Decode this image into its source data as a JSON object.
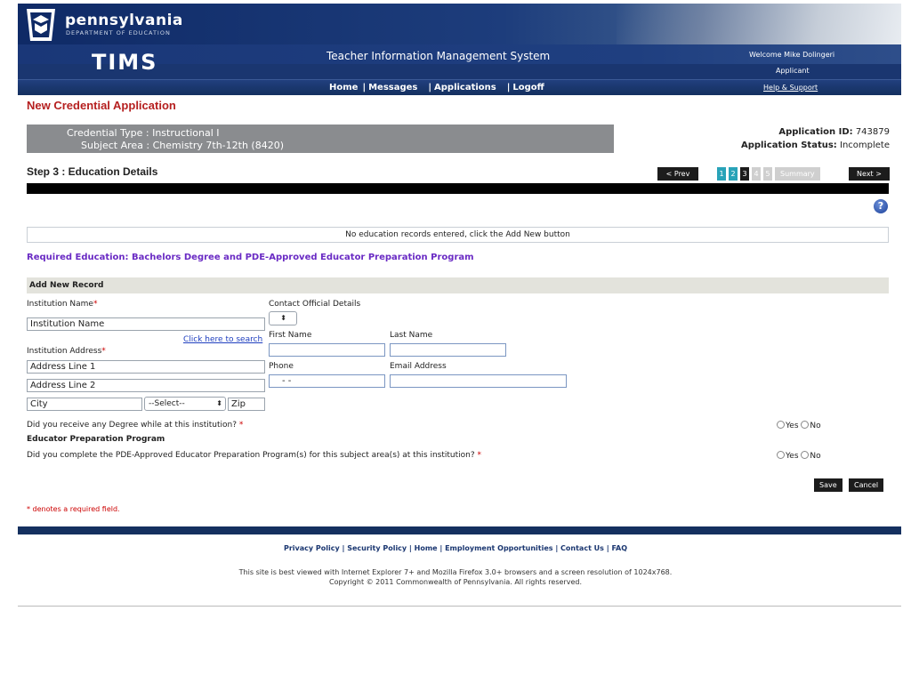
{
  "header": {
    "brand": "pennsylvania",
    "brand_sub": "DEPARTMENT OF EDUCATION",
    "app_short": "TIMS",
    "app_title": "Teacher Information Management System",
    "welcome": "Welcome Mike Dolingeri",
    "role": "Applicant",
    "help": "Help & Support",
    "nav": [
      "Home",
      "Messages",
      "Applications",
      "Logoff"
    ]
  },
  "page": {
    "title": "New Credential Application",
    "credential_type": "Credential Type : Instructional I",
    "subject_area": "Subject Area : Chemistry 7th-12th (8420)",
    "app_id_label": "Application ID:",
    "app_id_value": "743879",
    "app_status_label": "Application Status:",
    "app_status_value": "Incomplete",
    "step_title": "Step 3 : Education Details",
    "prev": "< Prev",
    "next": "Next >",
    "steps": [
      "1",
      "2",
      "3",
      "4",
      "5",
      "Summary"
    ],
    "help_icon": "?"
  },
  "records": {
    "empty_message": "No education records entered, click the Add New button",
    "required_education": "Required Education: Bachelors Degree and PDE-Approved Educator Preparation Program"
  },
  "form": {
    "section_title": "Add New Record",
    "institution_name_label": "Institution Name",
    "institution_name_value": "Institution Name",
    "search_link": "Click here to search",
    "institution_address_label": "Institution Address",
    "address1_value": "Address Line 1",
    "address2_value": "Address Line 2",
    "city_value": "City",
    "state_value": "--Select--",
    "zip_value": "Zip",
    "required_mark": "*",
    "contact_label": "Contact Official Details",
    "first_name_label": "First Name",
    "last_name_label": "Last Name",
    "phone_label": "Phone",
    "phone_value": "-   -",
    "email_label": "Email Address",
    "q_degree": "Did you receive any Degree while at this institution?",
    "epp_heading": "Educator Preparation Program",
    "q_epp": "Did you complete the PDE-Approved Educator Preparation Program(s) for this subject area(s) at this institution?",
    "yes": "Yes",
    "no": "No",
    "save": "Save",
    "cancel": "Cancel",
    "required_note": "* denotes a required field."
  },
  "footer": {
    "links": [
      "Privacy Policy",
      "Security Policy",
      "Home",
      "Employment Opportunities",
      "Contact Us",
      "FAQ"
    ],
    "browser_note": "This site is best viewed with Internet Explorer 7+ and Mozilla Firefox 3.0+ browsers and a screen resolution of 1024x768.",
    "copyright": "Copyright © 2011 Commonwealth of Pennsylvania. All rights reserved."
  }
}
